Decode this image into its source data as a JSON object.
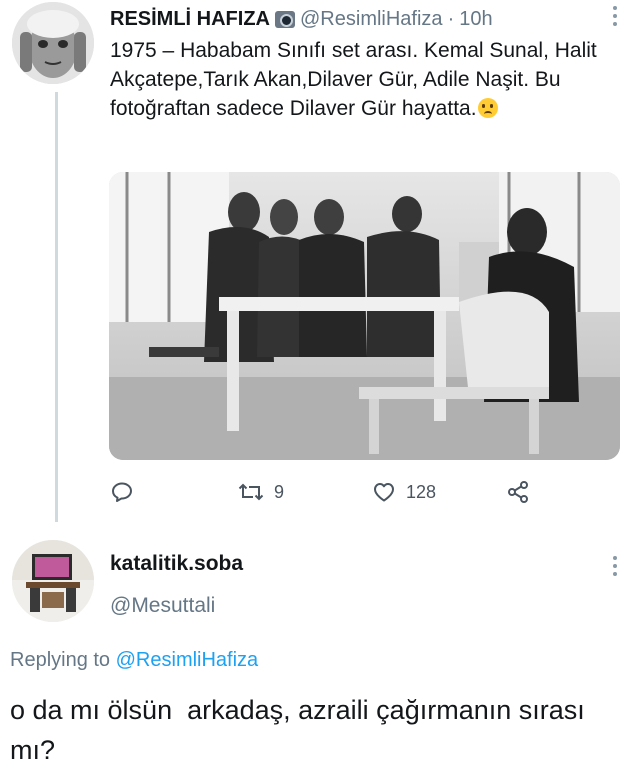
{
  "tweet": {
    "display_name": "RESİMLİ HAFIZA",
    "name_emoji": "camera-icon",
    "handle": "@ResimliHafiza",
    "separator": "·",
    "time": "10h",
    "text": "1975 – Hababam Sınıfı set arası. Kemal Sunal, Halit Akçatepe,Tarık Akan,Dilaver Gür, Adile Naşit. Bu fotoğraftan sadece Dilaver Gür hayatta.",
    "text_emoji": "crying-face-icon",
    "actions": {
      "reply_icon": "reply-icon",
      "retweet_icon": "retweet-icon",
      "retweet_count": "9",
      "like_icon": "heart-icon",
      "like_count": "128",
      "share_icon": "share-icon"
    }
  },
  "reply": {
    "display_name": "katalitik.soba",
    "handle": "@Mesuttali",
    "replying_prefix": "Replying to",
    "replying_to": "@ResimliHafiza",
    "text": "o da mı ölsün  arkadaş, azraili çağırmanın sırası mı?"
  },
  "colors": {
    "primary_text": "#14171a",
    "secondary_text": "#657786",
    "accent": "#1da1f2",
    "thread_line": "#cfd9de"
  }
}
